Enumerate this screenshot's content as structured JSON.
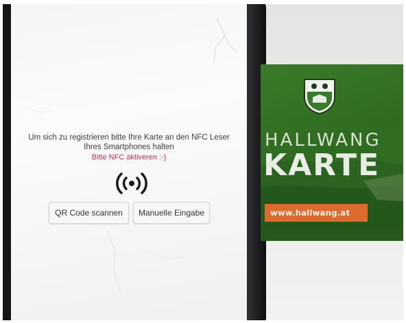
{
  "app": {
    "registration_text_line1": "Um sich zu registrieren bitte Ihre Karte an den NFC Leser",
    "registration_text_line2": "Ihres Smartphones halten",
    "nfc_hint": "Bitte NFC aktiveren :-)",
    "nfc_icon": "nfc-signal-icon",
    "buttons": {
      "qr_label": "QR Code scannen",
      "manual_label": "Manuelle Eingabe"
    }
  },
  "card": {
    "title_top": "HALLWANG",
    "title_bottom": "KARTE",
    "url": "www.hallwang.at",
    "logo_icon": "municipality-crest-icon",
    "colors": {
      "green": "#2f6c22",
      "orange": "#dd6a2e"
    }
  },
  "colors": {
    "hint": "#c4305a",
    "button_border": "#cfd3d6"
  }
}
